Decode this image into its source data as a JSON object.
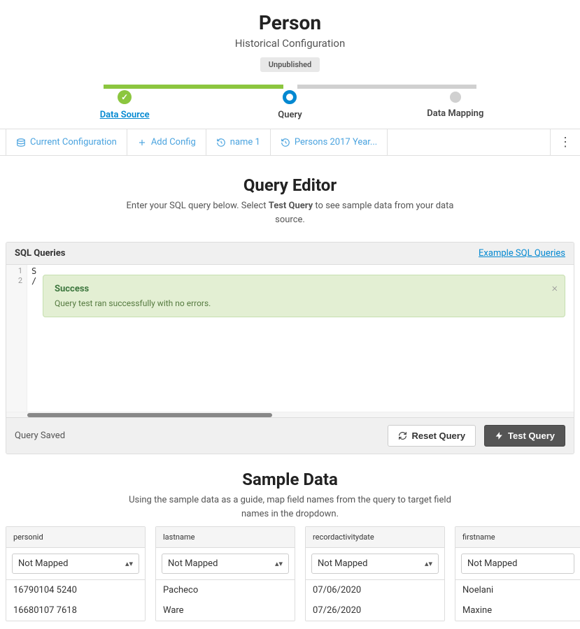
{
  "header": {
    "title": "Person",
    "subtitle": "Historical Configuration",
    "badge": "Unpublished"
  },
  "stepper": {
    "step1": "Data Source",
    "step2": "Query",
    "step3": "Data Mapping"
  },
  "tabs": {
    "current": "Current Configuration",
    "add": "Add Config",
    "name1": "name 1",
    "persons": "Persons 2017 Year..."
  },
  "queryEditor": {
    "title": "Query Editor",
    "desc_pre": "Enter your SQL query below. Select ",
    "desc_bold": "Test Query",
    "desc_post": " to see sample data from your data source.",
    "panelTitle": "SQL Queries",
    "exampleLink": "Example SQL Queries",
    "lines": {
      "l1": "1",
      "l2": "2"
    },
    "code": {
      "line1": "S",
      "line2": "/"
    },
    "alert": {
      "title": "Success",
      "msg": "Query test ran successfully with no errors."
    },
    "status": "Query Saved",
    "resetBtn": "Reset Query",
    "testBtn": "Test Query"
  },
  "sampleData": {
    "title": "Sample Data",
    "desc": "Using the sample data as a guide, map field names from the query to target field names in the dropdown.",
    "notMapped": "Not Mapped",
    "columns": [
      {
        "name": "personid",
        "rows": [
          "16790104 5240",
          "16680107 7618"
        ]
      },
      {
        "name": "lastname",
        "rows": [
          "Pacheco",
          "Ware"
        ]
      },
      {
        "name": "recordactivitydate",
        "rows": [
          "07/06/2020",
          "07/26/2020"
        ]
      },
      {
        "name": "firstname",
        "rows": [
          "Noelani",
          "Maxine"
        ]
      }
    ]
  }
}
